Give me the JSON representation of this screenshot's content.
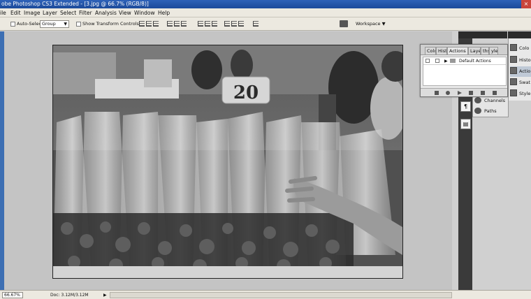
{
  "titlebar": {
    "title": "obe Photoshop CS3 Extended - [3.jpg @ 66.7% (RGB/8)]",
    "close": "×"
  },
  "menu": [
    "ile",
    "Edit",
    "Image",
    "Layer",
    "Select",
    "Filter",
    "Analysis",
    "View",
    "Window",
    "Help"
  ],
  "options": {
    "auto_select_label": "Auto-Select:",
    "group_value": "Group",
    "show_transform_label": "Show Transform Controls",
    "workspace_label": "Workspace"
  },
  "status": {
    "zoom": "66.67%",
    "doc": "Doc: 3.12M/3.12M"
  },
  "panels": {
    "actions_tabs": [
      "Colo",
      "Hist",
      "Actions ×",
      "Layers",
      "ths",
      "yles"
    ],
    "actions_row": "Default Actions",
    "channels": [
      "Channels",
      "Paths"
    ],
    "right_items": [
      "Colo",
      "Histo",
      "Actio",
      "Swat",
      "Style"
    ]
  },
  "photo": {
    "sign_text": "20"
  },
  "colors": {
    "titlebar": "#1c4a9a",
    "workspace": "#c4c4c4",
    "panel_bg": "#e7e7e7"
  }
}
